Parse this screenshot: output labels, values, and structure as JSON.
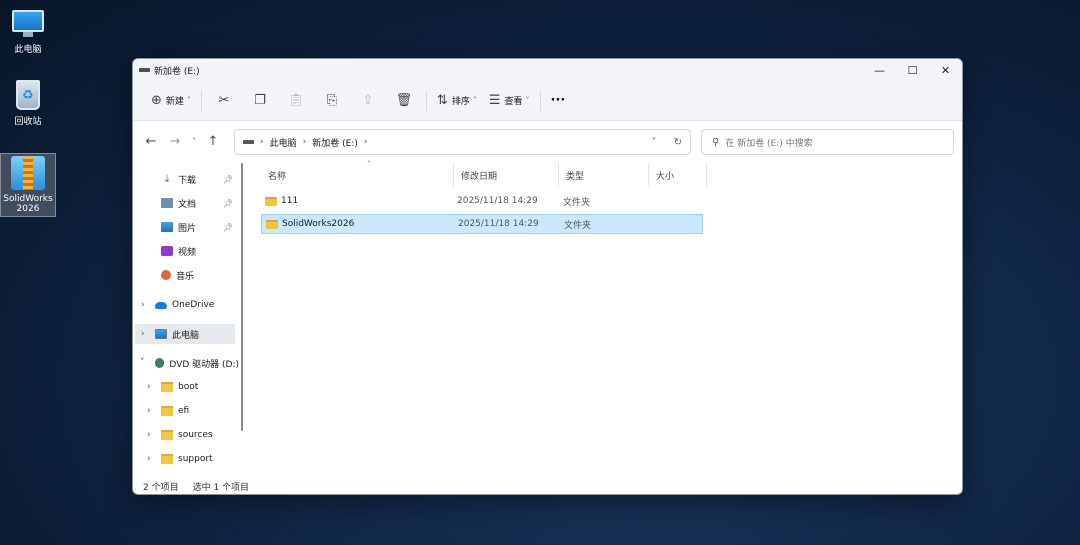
{
  "desktop": {
    "icons": [
      {
        "label": "此电脑"
      },
      {
        "label": "回收站"
      },
      {
        "label_line1": "SolidWorks",
        "label_line2": "2026"
      }
    ]
  },
  "window": {
    "title": "新加卷 (E:)",
    "controls": {
      "minimize": "—",
      "maximize": "☐",
      "close": "✕"
    }
  },
  "toolbar": {
    "new_label": "新建",
    "sort_label": "排序",
    "view_label": "查看",
    "more_label": "···"
  },
  "navigation": {
    "back": "←",
    "forward": "→",
    "recent": "˅",
    "up": "↑",
    "breadcrumb": [
      "此电脑",
      "新加卷 (E:)"
    ],
    "search_placeholder": "在 新加卷 (E:) 中搜索"
  },
  "sidebar": {
    "quick_access": [
      {
        "label": "下载",
        "pinned": true
      },
      {
        "label": "文档",
        "pinned": true
      },
      {
        "label": "图片",
        "pinned": true
      },
      {
        "label": "视频",
        "pinned": false
      },
      {
        "label": "音乐",
        "pinned": false
      }
    ],
    "onedrive": "OneDrive",
    "this_pc": "此电脑",
    "dvd": "DVD 驱动器 (D:)",
    "dvd_children": [
      "boot",
      "efi",
      "sources",
      "support"
    ]
  },
  "file_list": {
    "columns": [
      "名称",
      "修改日期",
      "类型",
      "大小"
    ],
    "rows": [
      {
        "name": "111",
        "date": "2025/11/18 14:29",
        "type": "文件夹",
        "selected": false
      },
      {
        "name": "SolidWorks2026",
        "date": "2025/11/18 14:29",
        "type": "文件夹",
        "selected": true
      }
    ]
  },
  "status": {
    "count": "2 个项目",
    "selected": "选中 1 个项目"
  },
  "colors": {
    "selection_bg": "#cce8ff",
    "selection_border": "#99d1ff",
    "folder": "#f1c444"
  }
}
